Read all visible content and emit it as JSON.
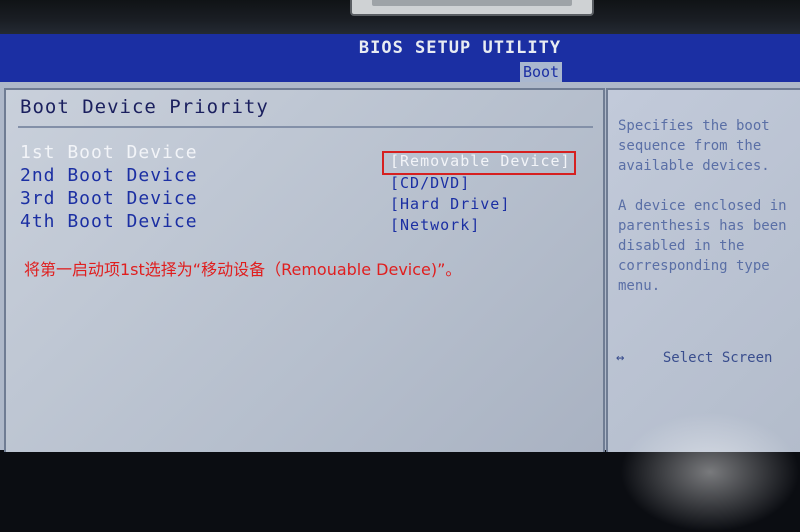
{
  "window": {
    "title": "BIOS SETUP UTILITY"
  },
  "tabs": [
    {
      "label": "Boot",
      "active": true
    }
  ],
  "section": {
    "title": "Boot Device Priority"
  },
  "boot_devices": [
    {
      "label": "1st Boot Device",
      "value": "[Removable Device]",
      "selected": true
    },
    {
      "label": "2nd Boot Device",
      "value": "[CD/DVD]",
      "selected": false
    },
    {
      "label": "3rd Boot Device",
      "value": "[Hard Drive]",
      "selected": false
    },
    {
      "label": "4th Boot Device",
      "value": "[Network]",
      "selected": false
    }
  ],
  "annotation": "将第一启动项1st选择为“移动设备（Remouable  Device)”。",
  "help": {
    "line1": "Specifies the boot",
    "line2": "sequence from the",
    "line3": "available devices.",
    "line4": "A device enclosed in",
    "line5": "parenthesis has been",
    "line6": "disabled in the",
    "line7": "corresponding type",
    "line8": "menu."
  },
  "key_help": {
    "arrow_symbol": "↔",
    "select_screen": "Select Screen"
  },
  "colors": {
    "title_bar_bg": "#1b2fa3",
    "panel_bg": "#aeb8c9",
    "highlight_border": "#d62020",
    "annotation_text": "#e01e1e"
  }
}
